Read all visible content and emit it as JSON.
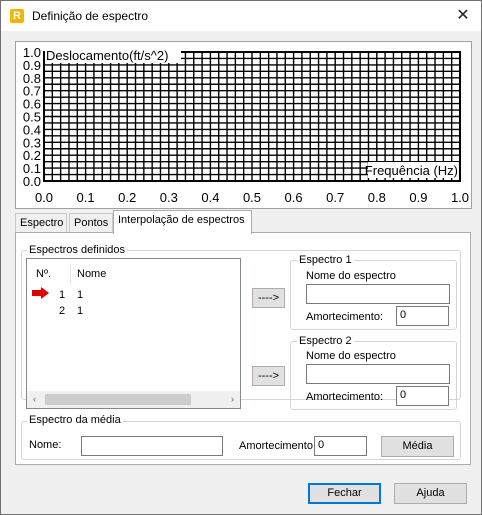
{
  "window": {
    "title": "Definição de espectro",
    "icon": "app-logo-icon",
    "close_glyph": "✕"
  },
  "chart_data": {
    "type": "line",
    "ylabel": "Deslocamento(ft/s^2)",
    "xlabel": "Frequência (Hz)",
    "xlim": [
      0,
      1
    ],
    "ylim": [
      0,
      1
    ],
    "x_ticks": [
      "0.0",
      "0.1",
      "0.2",
      "0.3",
      "0.4",
      "0.5",
      "0.6",
      "0.7",
      "0.8",
      "0.9",
      "1.0"
    ],
    "y_ticks": [
      "0.0",
      "0.1",
      "0.2",
      "0.3",
      "0.4",
      "0.5",
      "0.6",
      "0.7",
      "0.8",
      "0.9",
      "1.0"
    ],
    "grid": true,
    "series": []
  },
  "tabs": [
    "Espectro",
    "Pontos",
    "Interpolação de espectros"
  ],
  "active_tab": 2,
  "defined": {
    "group_label": "Espectros definidos",
    "columns": [
      "Nº.",
      "Nome"
    ],
    "rows": [
      {
        "no": "1",
        "name": "1",
        "selected_marker": true
      },
      {
        "no": "2",
        "name": "1",
        "selected_marker": false
      }
    ],
    "scroll_left": "‹",
    "scroll_right": "›",
    "marker_color": "#e00000"
  },
  "transfer_buttons": [
    "---->",
    "---->"
  ],
  "spectrum1": {
    "label": "Espectro 1",
    "name_label": "Nome do espectro",
    "name_value": "",
    "damping_label": "Amortecimento:",
    "damping_value": "0"
  },
  "spectrum2": {
    "label": "Espectro 2",
    "name_label": "Nome do espectro",
    "name_value": "",
    "damping_label": "Amortecimento:",
    "damping_value": "0"
  },
  "average": {
    "label": "Espectro da média",
    "name_label": "Nome:",
    "name_value": "",
    "damping_label": "Amortecimento",
    "damping_value": "0",
    "button": "Média"
  },
  "footer": {
    "close": "Fechar",
    "help": "Ajuda"
  }
}
